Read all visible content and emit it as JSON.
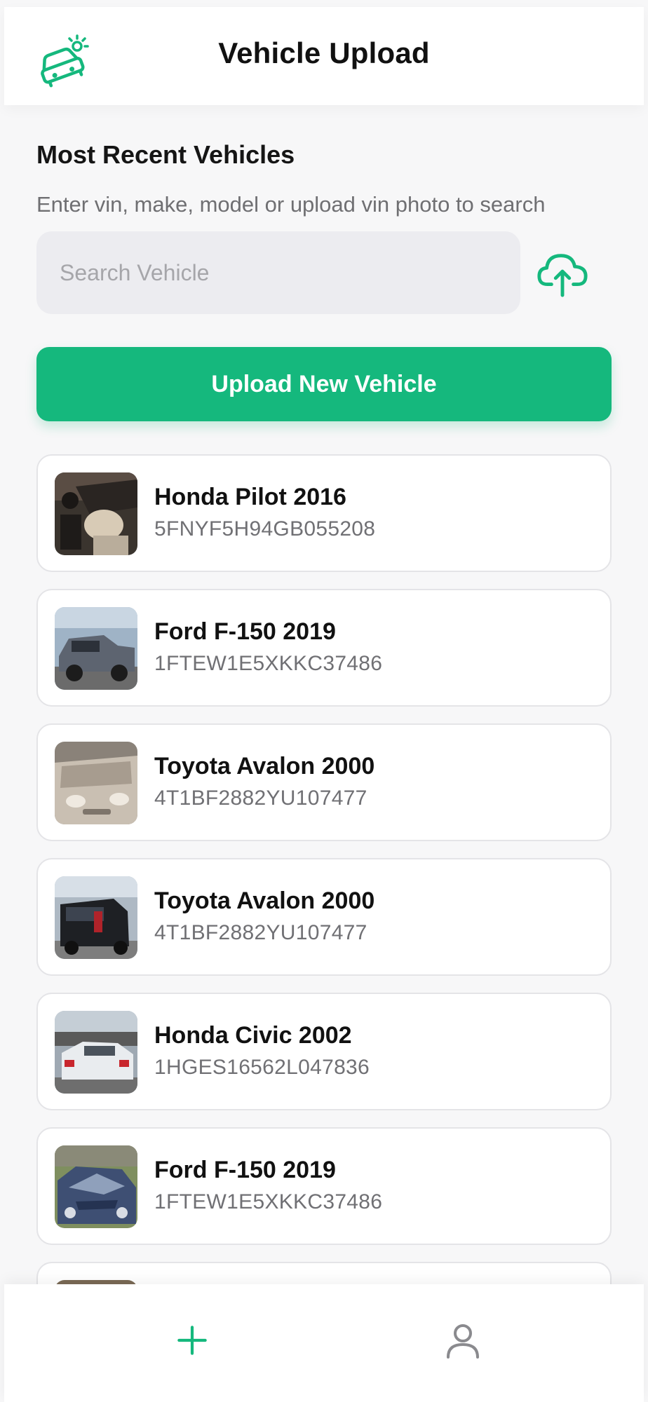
{
  "header": {
    "title": "Vehicle Upload",
    "logo_icon": "car-sparkle-icon"
  },
  "main": {
    "section_title": "Most Recent Vehicles",
    "helper_text": "Enter vin, make, model or upload vin photo to search",
    "search": {
      "placeholder": "Search Vehicle",
      "value": "",
      "upload_icon": "cloud-upload-icon"
    },
    "upload_button_label": "Upload New Vehicle",
    "vehicles": [
      {
        "name": "Honda Pilot 2016",
        "vin": "5FNYF5H94GB055208",
        "photo": "car-interior-photo"
      },
      {
        "name": "Ford F-150 2019",
        "vin": "1FTEW1E5XKKC37486",
        "photo": "grey-pickup-photo"
      },
      {
        "name": "Toyota Avalon 2000",
        "vin": "4T1BF2882YU107477",
        "photo": "beige-car-front-photo"
      },
      {
        "name": "Toyota Avalon 2000",
        "vin": "4T1BF2882YU107477",
        "photo": "black-car-rear-photo"
      },
      {
        "name": "Honda Civic 2002",
        "vin": "1HGES16562L047836",
        "photo": "white-sedan-photo"
      },
      {
        "name": "Ford F-150 2019",
        "vin": "1FTEW1E5XKKC37486",
        "photo": "damaged-blue-car-photo"
      }
    ]
  },
  "tabbar": {
    "add_icon": "plus-icon",
    "profile_icon": "user-icon"
  },
  "colors": {
    "accent": "#15b87d",
    "background": "#f7f7f8",
    "card_border": "#e4e4e7",
    "muted_text": "#707074"
  }
}
